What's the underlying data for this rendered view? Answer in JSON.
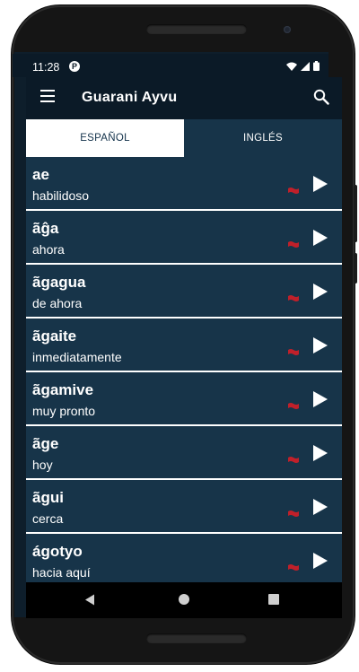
{
  "status_bar": {
    "time": "11:28",
    "app_indicator": "P"
  },
  "app_bar": {
    "title": "Guarani Ayvu",
    "menu_icon": "hamburger-menu-icon",
    "search_icon": "search-icon"
  },
  "tabs": [
    {
      "label": "ESPAÑOL",
      "active": true
    },
    {
      "label": "INGLÉS",
      "active": false
    }
  ],
  "colors": {
    "background": "#0e1e2b",
    "row": "#173449",
    "flag": "#c0202a",
    "tab_active_bg": "#ffffff",
    "tab_active_text": "#12314a"
  },
  "entries": [
    {
      "word": "ae",
      "meaning": "habilidoso"
    },
    {
      "word": "ãĝa",
      "meaning": "ahora"
    },
    {
      "word": "ãgagua",
      "meaning": "de ahora"
    },
    {
      "word": "ãgaite",
      "meaning": "inmediatamente"
    },
    {
      "word": "ãgamive",
      "meaning": "muy pronto"
    },
    {
      "word": "ãge",
      "meaning": "hoy"
    },
    {
      "word": "ãgui",
      "meaning": "cerca"
    },
    {
      "word": "ágotyo",
      "meaning": "hacia aquí"
    }
  ]
}
